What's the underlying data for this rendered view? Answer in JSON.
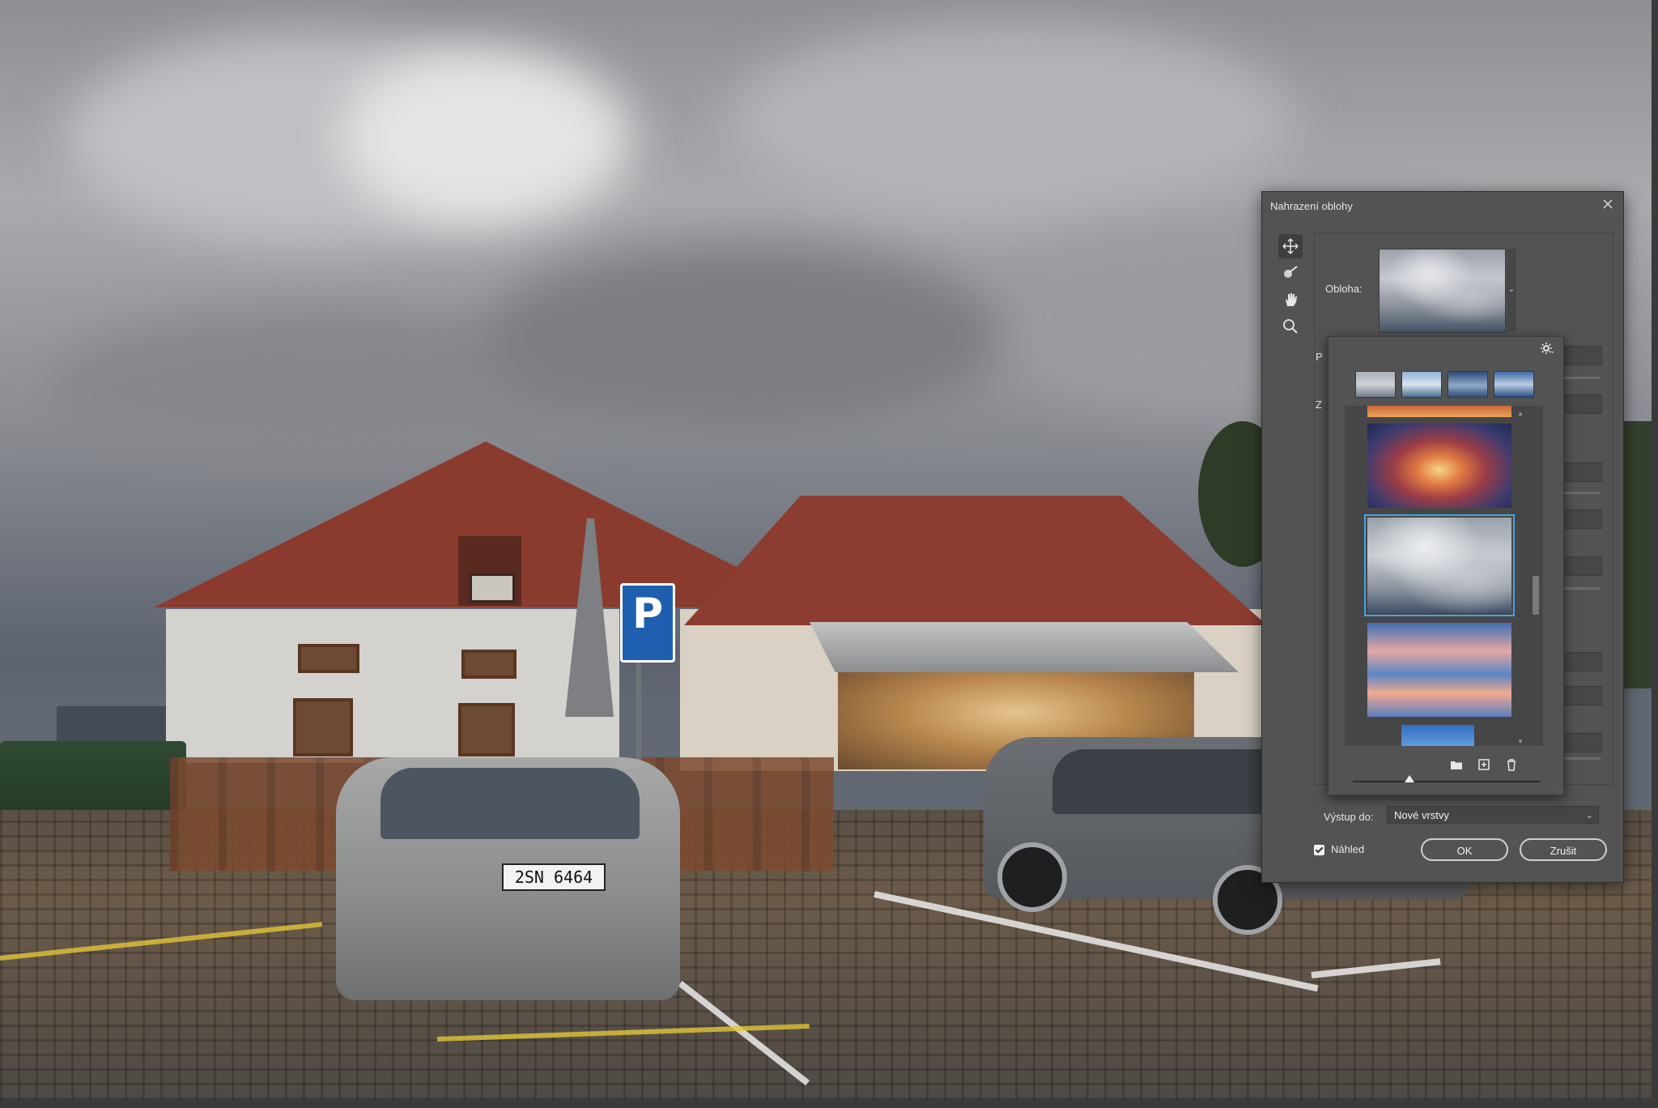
{
  "photo": {
    "parking_sign": "P",
    "license_plate": "2SN 6464"
  },
  "dialog": {
    "title": "Nahrazení oblohy",
    "close_icon": "close-icon",
    "tools": [
      "move-icon",
      "brush-icon",
      "hand-icon",
      "zoom-icon"
    ],
    "sky_label": "Obloha:",
    "partial_labels": [
      "P",
      "Z"
    ],
    "output_label": "Výstup do:",
    "output_value": "Nové vrstvy",
    "preview_label": "Náhled",
    "preview_checked": true,
    "ok_label": "OK",
    "cancel_label": "Zrušit"
  },
  "sky_picker": {
    "gear_icon": "gear-icon",
    "presets": [
      "preset-blue-sky",
      "preset-spectacular",
      "preset-sunsets",
      "preset-blue-clouds"
    ],
    "selected_index": 1,
    "items": [
      "sunset-fiery",
      "cloudy-gray",
      "pink-clouds",
      "blue-sky"
    ],
    "actions": [
      "folder-icon",
      "new-sky-icon",
      "trash-icon"
    ],
    "thumbnail_size_level": 0.3
  },
  "colors": {
    "dialog_bg": "#535353",
    "selection": "#41a5e8",
    "accent_yellow": "#e6d033"
  }
}
